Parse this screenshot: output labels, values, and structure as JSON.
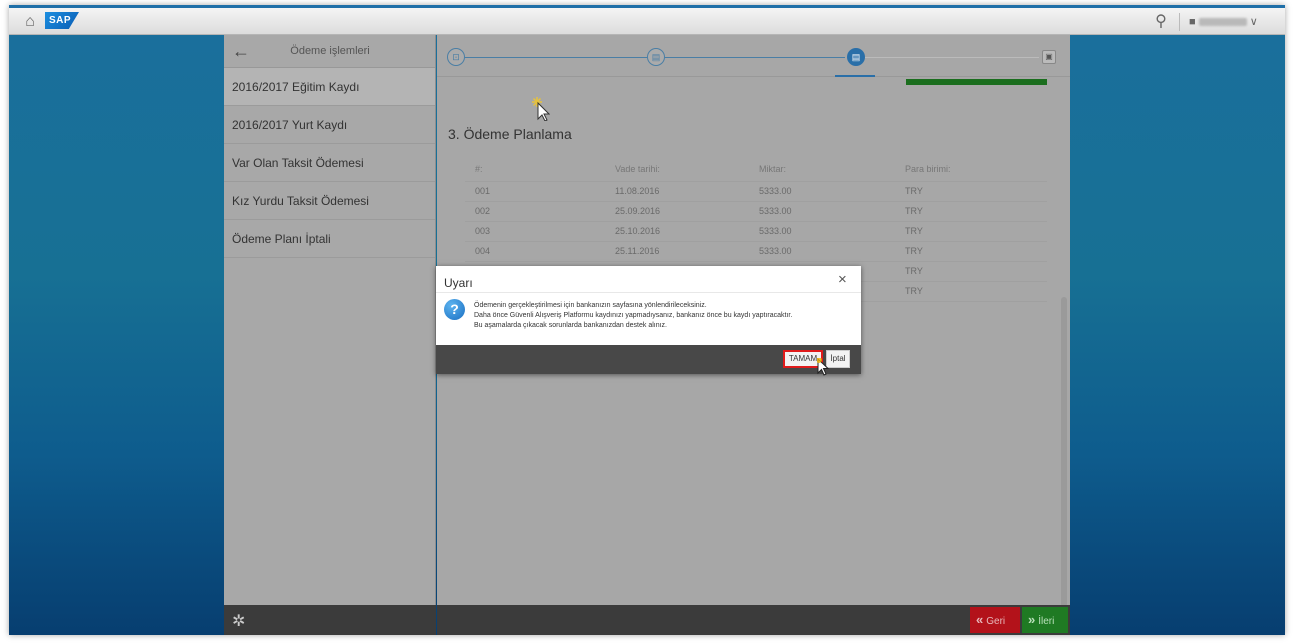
{
  "shell": {
    "logo_text": "SAP",
    "home_icon": "home-icon",
    "search_icon": "search-icon",
    "user_icon": "user-icon",
    "user_menu_caret": "∨"
  },
  "sidebar": {
    "title": "Ödeme işlemleri",
    "items": [
      {
        "label": "2016/2017 Eğitim Kaydı",
        "active": true
      },
      {
        "label": "2016/2017 Yurt Kaydı",
        "active": false
      },
      {
        "label": "Var Olan Taksit Ödemesi",
        "active": false
      },
      {
        "label": "Kız Yurdu Taksit Ödemesi",
        "active": false
      },
      {
        "label": "Ödeme Planı İptali",
        "active": false
      }
    ]
  },
  "main": {
    "section_title": "3. Ödeme Planlama",
    "table": {
      "headers": [
        "#:",
        "Vade tarihi:",
        "Miktar:",
        "Para birimi:"
      ],
      "rows": [
        [
          "001",
          "11.08.2016",
          "5333.00",
          "TRY"
        ],
        [
          "002",
          "25.09.2016",
          "5333.00",
          "TRY"
        ],
        [
          "003",
          "25.10.2016",
          "5333.00",
          "TRY"
        ],
        [
          "004",
          "25.11.2016",
          "5333.00",
          "TRY"
        ],
        [
          "",
          "",
          "",
          "TRY"
        ],
        [
          "",
          "",
          "",
          "TRY"
        ]
      ]
    },
    "footer": {
      "back_label": "Geri",
      "next_label": "İleri"
    }
  },
  "dialog": {
    "title": "Uyarı",
    "close_label": "×",
    "message_lines": [
      "Ödemenin gerçekleştirilmesi için bankanızın sayfasına yönlendirileceksiniz.",
      "Daha önce Güvenli Alışveriş Platformu kaydınızı yapmadıysanız, bankanız önce bu kaydı yaptıracaktır.",
      "Bu aşamalarda çıkacak sorunlarda bankanızdan destek alınız."
    ],
    "ok_label": "TAMAM",
    "cancel_label": "İptal"
  },
  "colors": {
    "accent": "#2a6fa8",
    "back_button": "#b3121a",
    "next_button": "#1f7a23",
    "highlight_border": "#e01b1b"
  }
}
